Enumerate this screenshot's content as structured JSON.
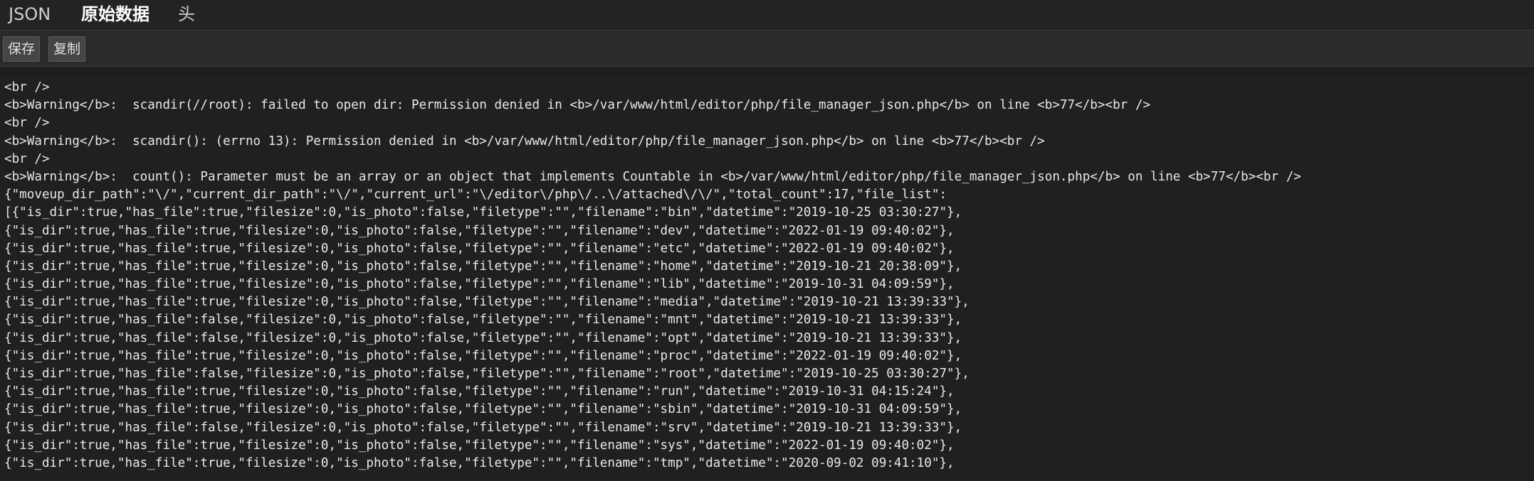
{
  "tabs": [
    {
      "label": "JSON"
    },
    {
      "label": "原始数据"
    },
    {
      "label": "头"
    }
  ],
  "toolbar": {
    "save_label": "保存",
    "copy_label": "复制"
  },
  "raw_lines": [
    "<br />",
    "<b>Warning</b>:  scandir(//root): failed to open dir: Permission denied in <b>/var/www/html/editor/php/file_manager_json.php</b> on line <b>77</b><br />",
    "<br />",
    "<b>Warning</b>:  scandir(): (errno 13): Permission denied in <b>/var/www/html/editor/php/file_manager_json.php</b> on line <b>77</b><br />",
    "<br />",
    "<b>Warning</b>:  count(): Parameter must be an array or an object that implements Countable in <b>/var/www/html/editor/php/file_manager_json.php</b> on line <b>77</b><br />",
    "{\"moveup_dir_path\":\"\\/\",\"current_dir_path\":\"\\/\",\"current_url\":\"\\/editor\\/php\\/..\\/attached\\/\\/\",\"total_count\":17,\"file_list\":",
    "[{\"is_dir\":true,\"has_file\":true,\"filesize\":0,\"is_photo\":false,\"filetype\":\"\",\"filename\":\"bin\",\"datetime\":\"2019-10-25 03:30:27\"},",
    "{\"is_dir\":true,\"has_file\":true,\"filesize\":0,\"is_photo\":false,\"filetype\":\"\",\"filename\":\"dev\",\"datetime\":\"2022-01-19 09:40:02\"},",
    "{\"is_dir\":true,\"has_file\":true,\"filesize\":0,\"is_photo\":false,\"filetype\":\"\",\"filename\":\"etc\",\"datetime\":\"2022-01-19 09:40:02\"},",
    "{\"is_dir\":true,\"has_file\":true,\"filesize\":0,\"is_photo\":false,\"filetype\":\"\",\"filename\":\"home\",\"datetime\":\"2019-10-21 20:38:09\"},",
    "{\"is_dir\":true,\"has_file\":true,\"filesize\":0,\"is_photo\":false,\"filetype\":\"\",\"filename\":\"lib\",\"datetime\":\"2019-10-31 04:09:59\"},",
    "{\"is_dir\":true,\"has_file\":true,\"filesize\":0,\"is_photo\":false,\"filetype\":\"\",\"filename\":\"media\",\"datetime\":\"2019-10-21 13:39:33\"},",
    "{\"is_dir\":true,\"has_file\":false,\"filesize\":0,\"is_photo\":false,\"filetype\":\"\",\"filename\":\"mnt\",\"datetime\":\"2019-10-21 13:39:33\"},",
    "{\"is_dir\":true,\"has_file\":false,\"filesize\":0,\"is_photo\":false,\"filetype\":\"\",\"filename\":\"opt\",\"datetime\":\"2019-10-21 13:39:33\"},",
    "{\"is_dir\":true,\"has_file\":true,\"filesize\":0,\"is_photo\":false,\"filetype\":\"\",\"filename\":\"proc\",\"datetime\":\"2022-01-19 09:40:02\"},",
    "{\"is_dir\":true,\"has_file\":false,\"filesize\":0,\"is_photo\":false,\"filetype\":\"\",\"filename\":\"root\",\"datetime\":\"2019-10-25 03:30:27\"},",
    "{\"is_dir\":true,\"has_file\":true,\"filesize\":0,\"is_photo\":false,\"filetype\":\"\",\"filename\":\"run\",\"datetime\":\"2019-10-31 04:15:24\"},",
    "{\"is_dir\":true,\"has_file\":true,\"filesize\":0,\"is_photo\":false,\"filetype\":\"\",\"filename\":\"sbin\",\"datetime\":\"2019-10-31 04:09:59\"},",
    "{\"is_dir\":true,\"has_file\":false,\"filesize\":0,\"is_photo\":false,\"filetype\":\"\",\"filename\":\"srv\",\"datetime\":\"2019-10-21 13:39:33\"},",
    "{\"is_dir\":true,\"has_file\":true,\"filesize\":0,\"is_photo\":false,\"filetype\":\"\",\"filename\":\"sys\",\"datetime\":\"2022-01-19 09:40:02\"},",
    "{\"is_dir\":true,\"has_file\":true,\"filesize\":0,\"is_photo\":false,\"filetype\":\"\",\"filename\":\"tmp\",\"datetime\":\"2020-09-02 09:41:10\"},"
  ]
}
